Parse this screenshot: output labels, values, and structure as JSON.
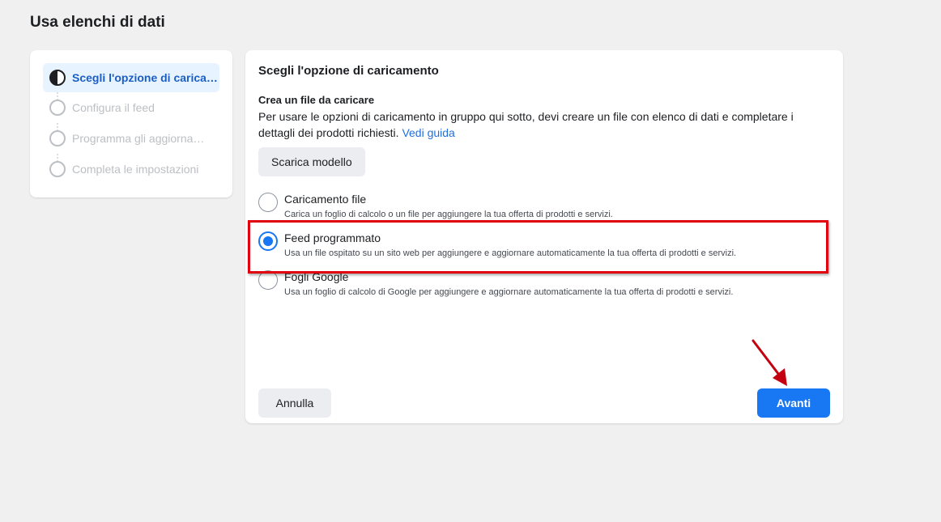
{
  "page": {
    "title": "Usa elenchi di dati"
  },
  "steps": [
    {
      "label": "Scegli l'opzione di carica…",
      "state": "active"
    },
    {
      "label": "Configura il feed",
      "state": "pending"
    },
    {
      "label": "Programma gli aggiorna…",
      "state": "pending"
    },
    {
      "label": "Completa le impostazioni",
      "state": "pending"
    }
  ],
  "main": {
    "title": "Scegli l'opzione di caricamento",
    "section_title": "Crea un file da caricare",
    "section_desc": "Per usare le opzioni di caricamento in gruppo qui sotto, devi creare un file con elenco di dati e completare i dettagli dei prodotti richiesti.",
    "guide_link": "Vedi guida",
    "template_button": "Scarica modello",
    "options": [
      {
        "title": "Caricamento file",
        "desc": "Carica un foglio di calcolo o un file per aggiungere la tua offerta di prodotti e servizi.",
        "selected": false
      },
      {
        "title": "Feed programmato",
        "desc": "Usa un file ospitato su un sito web per aggiungere e aggiornare automaticamente la tua offerta di prodotti e servizi.",
        "selected": true
      },
      {
        "title": "Fogli Google",
        "desc": "Usa un foglio di calcolo di Google per aggiungere e aggiornare automaticamente la tua offerta di prodotti e servizi.",
        "selected": false
      }
    ],
    "cancel_button": "Annulla",
    "next_button": "Avanti"
  },
  "colors": {
    "accent": "#1877f2",
    "highlight": "#e0000e",
    "active_step_bg": "#e7f3ff"
  },
  "icons": {
    "step_active": "half-filled-circle-icon",
    "step_pending": "empty-circle-icon",
    "annotation": "red-arrow-icon"
  }
}
